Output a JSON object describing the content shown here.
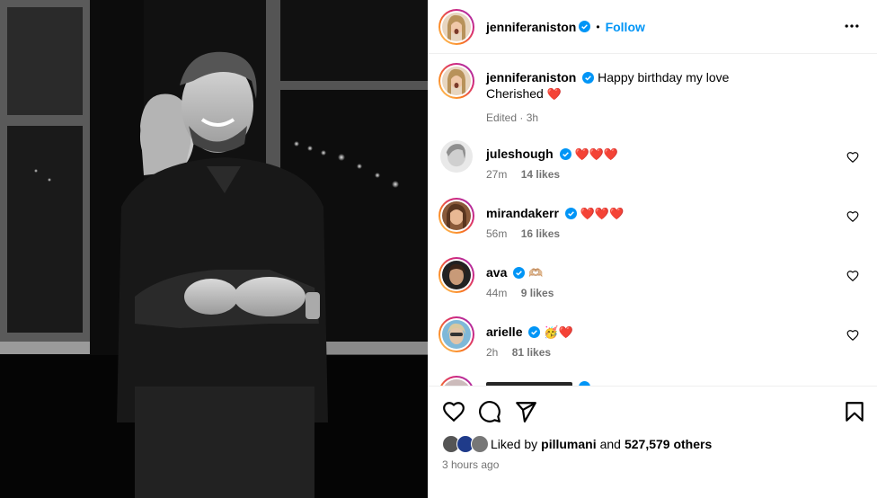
{
  "post": {
    "author": "jenniferaniston",
    "follow_label": "Follow",
    "dot": "•",
    "caption_line1": "Happy birthday my love",
    "caption_line2": "Cherished",
    "caption_heart": "❤️",
    "caption_meta": "Edited · 3h"
  },
  "comments": [
    {
      "user": "juleshough",
      "text": "❤️❤️❤️",
      "time": "27m",
      "likes": "14 likes"
    },
    {
      "user": "mirandakerr",
      "text": "❤️❤️❤️",
      "time": "56m",
      "likes": "16 likes"
    },
    {
      "user": "ava",
      "text": "🫶🏼",
      "time": "44m",
      "likes": "9 likes"
    },
    {
      "user": "arielle",
      "text": "🥳❤️",
      "time": "2h",
      "likes": "81 likes"
    }
  ],
  "liked_by": {
    "prefix": "Liked by",
    "user": "pillumani",
    "and": "and",
    "others": "527,579 others"
  },
  "timestamp": "3 hours ago",
  "colors": {
    "follow": "#0095f6",
    "verified": "#0095f6",
    "heart": "#ed1c24",
    "meta": "#737373"
  },
  "icons": [
    "more-options-icon",
    "verified-icon",
    "heart-icon",
    "comment-icon",
    "share-icon",
    "bookmark-icon"
  ]
}
